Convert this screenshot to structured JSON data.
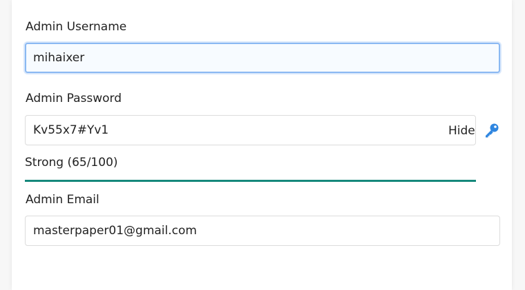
{
  "form": {
    "username": {
      "label": "Admin Username",
      "value": "mihaixer"
    },
    "password": {
      "label": "Admin Password",
      "value": "Kv55x7#Yv1",
      "toggle_label": "Hide",
      "generate_icon": "key-icon"
    },
    "strength": {
      "text": "Strong (65/100)",
      "fill_fraction": 1.0,
      "color": "#15887b"
    },
    "email": {
      "label": "Admin Email",
      "value": "masterpaper01@gmail.com"
    }
  },
  "colors": {
    "focus_border": "#8ab8f2",
    "key_icon": "#2f86e0",
    "strength_bar": "#15887b"
  }
}
